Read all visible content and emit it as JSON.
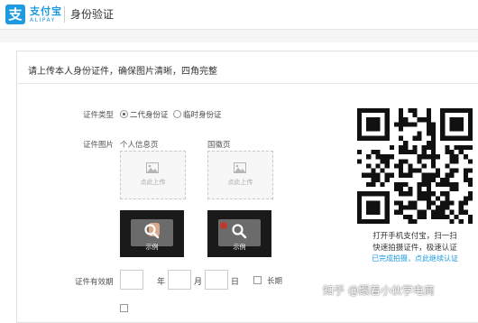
{
  "header": {
    "logo_glyph": "支",
    "brand": "支付宝",
    "brand_en": "ALIPAY",
    "title": "身份验证"
  },
  "intro": "请上传本人身份证件，确保图片清晰，四角完整",
  "form": {
    "type_label": "证件类型",
    "type_options": [
      "二代身份证",
      "临时身份证"
    ],
    "type_selected": "二代身份证",
    "image_label": "证件图片",
    "front_label": "个人信息页",
    "back_label": "国徽页",
    "upload_text": "点此上传",
    "example_text": "示例",
    "validity_label": "证件有效期",
    "year_unit": "年",
    "month_unit": "月",
    "day_unit": "日",
    "long_term_label": "长期"
  },
  "qr": {
    "line1": "打开手机支付宝，扫一扫",
    "line2": "快速拍摄证件，极速认证",
    "link": "已完成拍摄，点此继续认证"
  },
  "watermark": "知乎 @跟着小伙学电商",
  "colors": {
    "accent": "#1e9ae0"
  }
}
